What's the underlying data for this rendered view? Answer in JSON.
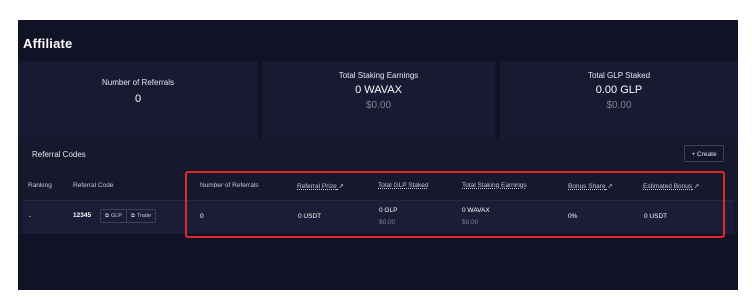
{
  "page": {
    "title": "Affiliate"
  },
  "stats": [
    {
      "label": "Number of Referrals",
      "value": "0",
      "sub": ""
    },
    {
      "label": "Total Staking Earnings",
      "value": "0 WAVAX",
      "sub": "$0.00"
    },
    {
      "label": "Total GLP Staked",
      "value": "0.00 GLP",
      "sub": "$0.00"
    }
  ],
  "referral_codes": {
    "title": "Referral Codes",
    "create_label": "Create",
    "create_icon": "plus-icon",
    "columns": {
      "ranking": "Ranking",
      "referral_code": "Referral Code",
      "number_of_referrals": "Number of Referrals",
      "referral_prize": "Referral Prize",
      "total_glp_staked": "Total GLP Staked",
      "total_staking_earnings": "Total Staking Earnings",
      "bonus_share": "Bonus Share",
      "estimated_bonus": "Estimated Bonus"
    },
    "rows": [
      {
        "ranking": "-",
        "code": "12345",
        "actions": {
          "glp": "GLP",
          "trade": "Trade"
        },
        "number_of_referrals": "0",
        "referral_prize": "0 USDT",
        "total_glp_staked": "0 GLP",
        "total_glp_staked_usd": "$0.00",
        "total_staking_earnings": "0 WAVAX",
        "total_staking_earnings_usd": "$0.00",
        "bonus_share": "0%",
        "estimated_bonus": "0 USDT"
      }
    ]
  },
  "colors": {
    "background": "#111226",
    "card": "#171a31",
    "highlight": "#e02a2a",
    "muted_text": "#7e8094"
  }
}
